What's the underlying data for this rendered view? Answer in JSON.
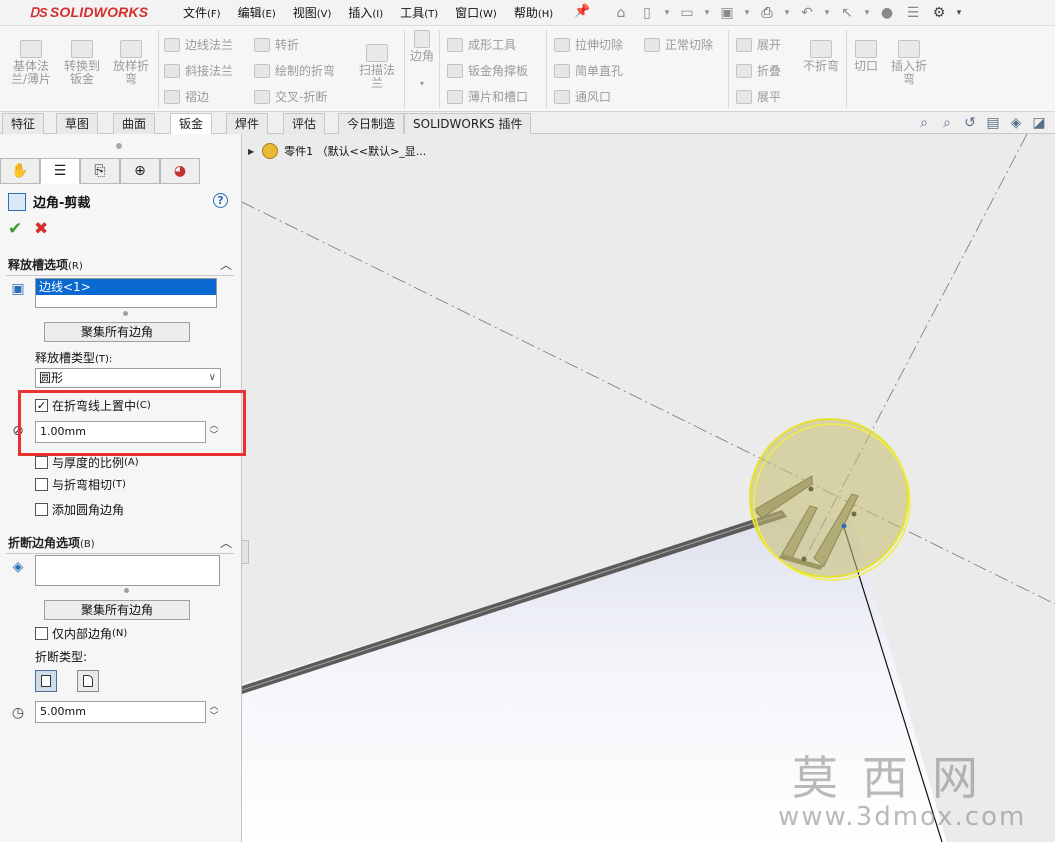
{
  "app": {
    "logo": "SOLIDWORKS",
    "brand_color": "#d32f2f",
    "accent_color": "#0a69d1",
    "highlight_color": "#e8322f"
  },
  "menu": [
    {
      "label": "文件",
      "key": "(F)"
    },
    {
      "label": "编辑",
      "key": "(E)"
    },
    {
      "label": "视图",
      "key": "(V)"
    },
    {
      "label": "插入",
      "key": "(I)"
    },
    {
      "label": "工具",
      "key": "(T)"
    },
    {
      "label": "窗口",
      "key": "(W)"
    },
    {
      "label": "帮助",
      "key": "(H)"
    }
  ],
  "ribbon": {
    "base_flange": "基体法\n兰/薄片",
    "convert": "转换到\n钣金",
    "lofted_bend": "放样折\n弯",
    "edge_flange": "边线法兰",
    "miter_flange": "斜接法兰",
    "hem": "褶边",
    "jog": "转折",
    "sketched_bend": "绘制的折弯",
    "cross_break": "交叉-折断",
    "swept_flange": "扫描法\n兰",
    "corners": "边角",
    "forming_tool": "成形工具",
    "gusset": "钣金角撑板",
    "tab_slot": "薄片和槽口",
    "extruded_cut": "拉伸切除",
    "simple_hole": "简单直孔",
    "vent": "通风口",
    "normal_cut": "正常切除",
    "unfold": "展开",
    "fold": "折叠",
    "flatten": "展平",
    "no_bends": "不折弯",
    "rip": "切口",
    "insert_bends": "插入折\n弯"
  },
  "tabs": [
    {
      "label": "特征",
      "active": false
    },
    {
      "label": "草图",
      "active": false
    },
    {
      "label": "曲面",
      "active": false
    },
    {
      "label": "钣金",
      "active": true
    },
    {
      "label": "焊件",
      "active": false
    },
    {
      "label": "评估",
      "active": false
    },
    {
      "label": "今日制造",
      "active": false
    },
    {
      "label": "SOLIDWORKS 插件",
      "active": false
    }
  ],
  "tree": {
    "part_label": "零件1 （默认<<默认>_显..."
  },
  "property_manager": {
    "title": "边角-剪裁",
    "relief_section": {
      "label": "释放槽选项",
      "key": "(R)"
    },
    "edge_list": [
      "边线<1>"
    ],
    "collect_all": "聚集所有边角",
    "relief_type_label": "释放槽类型",
    "relief_type_key": "(T):",
    "relief_type_value": "圆形",
    "center_on_bend": {
      "label": "在折弯线上置中",
      "key": "(C)",
      "checked": true
    },
    "relief_distance": "1.00mm",
    "ratio_to_thickness": {
      "label": "与厚度的比例",
      "key": "(A)",
      "checked": false
    },
    "tangent_to_bend": {
      "label": "与折弯相切",
      "key": "(T)",
      "checked": false
    },
    "add_fillet": {
      "label": "添加圆角边角",
      "checked": false
    },
    "break_section": {
      "label": "折断边角选项",
      "key": "(B)"
    },
    "collect_all_2": "聚集所有边角",
    "internal_only": {
      "label": "仅内部边角",
      "key": "(N)",
      "checked": false
    },
    "break_type_label": "折断类型:",
    "break_distance": "5.00mm"
  },
  "watermark": {
    "line1": "莫西网",
    "line2": "www.3dmox.com"
  }
}
